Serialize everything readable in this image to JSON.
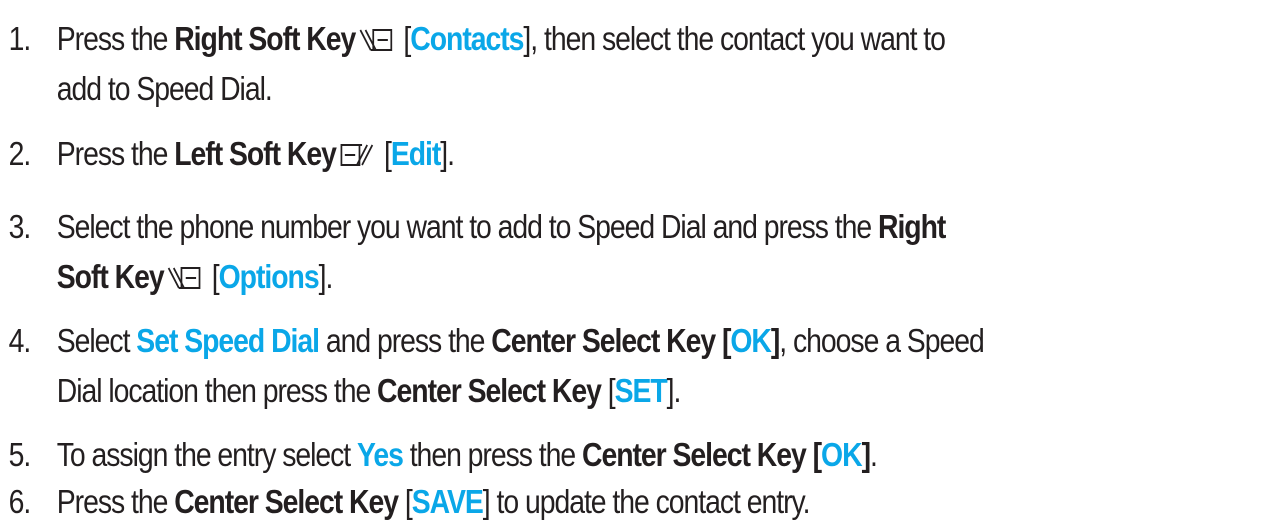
{
  "steps": [
    {
      "num": "1.",
      "line1": {
        "t1": "Press the ",
        "key": "Right Soft Key",
        "icon": "right-soft-key-icon",
        "br_open": " [",
        "action": "Contacts",
        "br_close": "], then select the contact you want to"
      },
      "line2": "add to Speed Dial."
    },
    {
      "num": "2.",
      "t1": "Press the ",
      "key": "Left Soft Key",
      "icon": "left-soft-key-icon",
      "br_open": " [",
      "action": "Edit",
      "br_close": "]."
    },
    {
      "num": "3.",
      "line1": {
        "t1": "Select the phone number you want to add to Speed Dial and press the ",
        "key": "Right"
      },
      "line2": {
        "key": "Soft Key",
        "icon": "right-soft-key-icon",
        "br_open": " [",
        "action": "Options",
        "br_close": "]."
      }
    },
    {
      "num": "4.",
      "line1": {
        "t1": "Select ",
        "action": "Set Speed Dial",
        "t2": " and press the ",
        "key": "Center Select Key [",
        "ok": "OK",
        "key_close": "]",
        "t3": ", choose a Speed"
      },
      "line2": {
        "t1": "Dial location then press the ",
        "key": "Center Select Key",
        "br_open": " [",
        "action": "SET",
        "br_close": "]."
      }
    },
    {
      "num": "5.",
      "t1": "To assign the entry select ",
      "action": "Yes",
      "t2": " then press the ",
      "key": "Center Select Key [",
      "ok": "OK",
      "key_close": "]",
      "t3": "."
    },
    {
      "num": "6.",
      "t1": "Press the ",
      "key": "Center Select Key",
      "br_open": " [",
      "action": "SAVE",
      "br_close": "] to update the contact entry."
    }
  ],
  "colors": {
    "text": "#231f20",
    "highlight": "#0aa7e8"
  }
}
